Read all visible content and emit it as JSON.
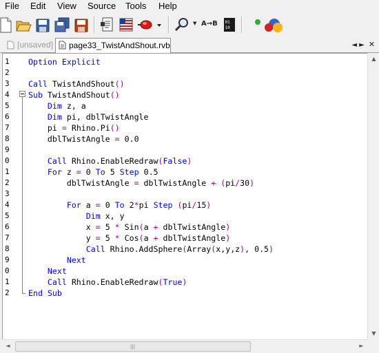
{
  "menu": [
    "File",
    "Edit",
    "View",
    "Source",
    "Tools",
    "Help"
  ],
  "toolbar": {
    "buttons": [
      "new-file-icon",
      "open-folder-icon",
      "save-icon",
      "save-all-icon",
      "save-as-icon",
      "page-setup-icon",
      "flag-icon",
      "run-script-icon",
      "dropdown-icon",
      "find-icon",
      "replace-icon",
      "binary-icon",
      "rhino-objects-icon"
    ],
    "find_dropdown_glyph": "▼",
    "replace_label": "A→B"
  },
  "tabs": [
    {
      "label": "[unsaved]",
      "active": false
    },
    {
      "label": "page33_TwistAndShout.rvb",
      "active": true
    }
  ],
  "tab_nav": [
    "◄",
    "►",
    "✕"
  ],
  "colors": {
    "keyword": "#0000ff",
    "operator": "#a000a0",
    "text": "#000000"
  },
  "code_lines": [
    {
      "n": "1",
      "tokens": [
        {
          "t": "Option Explicit",
          "c": "kw"
        }
      ]
    },
    {
      "n": "2",
      "tokens": []
    },
    {
      "n": "3",
      "tokens": [
        {
          "t": "Call",
          "c": "kw"
        },
        {
          "t": " TwistAndShout"
        },
        {
          "t": "()",
          "c": "op"
        }
      ]
    },
    {
      "n": "4",
      "tokens": [
        {
          "t": "Sub",
          "c": "kw"
        },
        {
          "t": " TwistAndShout"
        },
        {
          "t": "()",
          "c": "op"
        }
      ]
    },
    {
      "n": "5",
      "tokens": [
        {
          "t": "    "
        },
        {
          "t": "Dim",
          "c": "kw"
        },
        {
          "t": " z, a"
        }
      ]
    },
    {
      "n": "6",
      "tokens": [
        {
          "t": "    "
        },
        {
          "t": "Dim",
          "c": "kw"
        },
        {
          "t": " pi, dblTwistAngle"
        }
      ]
    },
    {
      "n": "7",
      "tokens": [
        {
          "t": "    pi "
        },
        {
          "t": "=",
          "c": "op"
        },
        {
          "t": " Rhino.Pi"
        },
        {
          "t": "()",
          "c": "op"
        }
      ]
    },
    {
      "n": "8",
      "tokens": [
        {
          "t": "    dblTwistAngle "
        },
        {
          "t": "=",
          "c": "op"
        },
        {
          "t": " 0.0"
        }
      ]
    },
    {
      "n": "9",
      "tokens": []
    },
    {
      "n": "0",
      "tokens": [
        {
          "t": "    "
        },
        {
          "t": "Call",
          "c": "kw"
        },
        {
          "t": " Rhino.EnableRedraw"
        },
        {
          "t": "(",
          "c": "op"
        },
        {
          "t": "False",
          "c": "kw"
        },
        {
          "t": ")",
          "c": "op"
        }
      ]
    },
    {
      "n": "1",
      "tokens": [
        {
          "t": "    "
        },
        {
          "t": "For",
          "c": "kw"
        },
        {
          "t": " z "
        },
        {
          "t": "=",
          "c": "op"
        },
        {
          "t": " 0 "
        },
        {
          "t": "To",
          "c": "kw"
        },
        {
          "t": " 5 "
        },
        {
          "t": "Step",
          "c": "kw"
        },
        {
          "t": " 0.5"
        }
      ]
    },
    {
      "n": "2",
      "tokens": [
        {
          "t": "        dblTwistAngle "
        },
        {
          "t": "=",
          "c": "op"
        },
        {
          "t": " dblTwistAngle "
        },
        {
          "t": "+",
          "c": "op"
        },
        {
          "t": " "
        },
        {
          "t": "(",
          "c": "op"
        },
        {
          "t": "pi"
        },
        {
          "t": "/",
          "c": "op"
        },
        {
          "t": "30"
        },
        {
          "t": ")",
          "c": "op"
        }
      ]
    },
    {
      "n": "3",
      "tokens": []
    },
    {
      "n": "4",
      "tokens": [
        {
          "t": "        "
        },
        {
          "t": "For",
          "c": "kw"
        },
        {
          "t": " a "
        },
        {
          "t": "=",
          "c": "op"
        },
        {
          "t": " 0 "
        },
        {
          "t": "To",
          "c": "kw"
        },
        {
          "t": " 2"
        },
        {
          "t": "*",
          "c": "op"
        },
        {
          "t": "pi "
        },
        {
          "t": "Step",
          "c": "kw"
        },
        {
          "t": " "
        },
        {
          "t": "(",
          "c": "op"
        },
        {
          "t": "pi"
        },
        {
          "t": "/",
          "c": "op"
        },
        {
          "t": "15"
        },
        {
          "t": ")",
          "c": "op"
        }
      ]
    },
    {
      "n": "5",
      "tokens": [
        {
          "t": "            "
        },
        {
          "t": "Dim",
          "c": "kw"
        },
        {
          "t": " x, y"
        }
      ]
    },
    {
      "n": "6",
      "tokens": [
        {
          "t": "            x "
        },
        {
          "t": "=",
          "c": "op"
        },
        {
          "t": " 5 "
        },
        {
          "t": "*",
          "c": "op"
        },
        {
          "t": " Sin"
        },
        {
          "t": "(",
          "c": "op"
        },
        {
          "t": "a "
        },
        {
          "t": "+",
          "c": "op"
        },
        {
          "t": " dblTwistAngle"
        },
        {
          "t": ")",
          "c": "op"
        }
      ]
    },
    {
      "n": "7",
      "tokens": [
        {
          "t": "            y "
        },
        {
          "t": "=",
          "c": "op"
        },
        {
          "t": " 5 "
        },
        {
          "t": "*",
          "c": "op"
        },
        {
          "t": " Cos"
        },
        {
          "t": "(",
          "c": "op"
        },
        {
          "t": "a "
        },
        {
          "t": "+",
          "c": "op"
        },
        {
          "t": " dblTwistAngle"
        },
        {
          "t": ")",
          "c": "op"
        }
      ]
    },
    {
      "n": "8",
      "tokens": [
        {
          "t": "            "
        },
        {
          "t": "Call",
          "c": "kw"
        },
        {
          "t": " Rhino.AddSphere"
        },
        {
          "t": "(",
          "c": "op"
        },
        {
          "t": "Array"
        },
        {
          "t": "(",
          "c": "op"
        },
        {
          "t": "x,y,z"
        },
        {
          "t": ")",
          "c": "op"
        },
        {
          "t": ", 0.5"
        },
        {
          "t": ")",
          "c": "op"
        }
      ]
    },
    {
      "n": "9",
      "tokens": [
        {
          "t": "        "
        },
        {
          "t": "Next",
          "c": "kw"
        }
      ]
    },
    {
      "n": "0",
      "tokens": [
        {
          "t": "    "
        },
        {
          "t": "Next",
          "c": "kw"
        }
      ]
    },
    {
      "n": "1",
      "tokens": [
        {
          "t": "    "
        },
        {
          "t": "Call",
          "c": "kw"
        },
        {
          "t": " Rhino.EnableRedraw"
        },
        {
          "t": "(",
          "c": "op"
        },
        {
          "t": "True",
          "c": "kw"
        },
        {
          "t": ")",
          "c": "op"
        }
      ]
    },
    {
      "n": "2",
      "tokens": [
        {
          "t": "End Sub",
          "c": "kw"
        }
      ]
    }
  ],
  "scroll": {
    "grip": "|||",
    "up": "▲",
    "down": "▼",
    "left": "◄",
    "right": "►"
  }
}
